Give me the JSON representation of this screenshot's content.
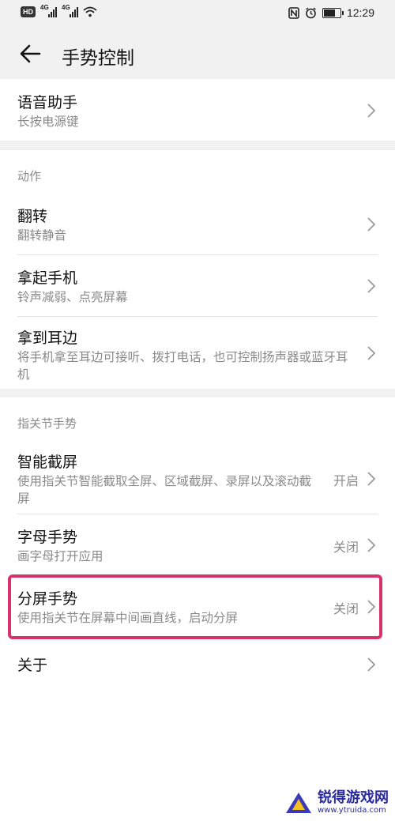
{
  "status_bar": {
    "hd": "HD",
    "net1": "4G",
    "net2": "4G",
    "time": "12:29",
    "battery_level": 0.8
  },
  "header": {
    "title": "手势控制"
  },
  "voice": {
    "title": "语音助手",
    "subtitle": "长按电源键"
  },
  "actions": {
    "section_label": "动作",
    "items": [
      {
        "title": "翻转",
        "subtitle": "翻转静音"
      },
      {
        "title": "拿起手机",
        "subtitle": "铃声减弱、点亮屏幕"
      },
      {
        "title": "拿到耳边",
        "subtitle": "将手机拿至耳边可接听、拨打电话，也可控制扬声器或蓝牙耳机"
      }
    ]
  },
  "knuckle": {
    "section_label": "指关节手势",
    "items": [
      {
        "title": "智能截屏",
        "subtitle": "使用指关节智能截取全屏、区域截屏、录屏以及滚动截屏",
        "value": "开启"
      },
      {
        "title": "字母手势",
        "subtitle": "画字母打开应用",
        "value": "关闭"
      },
      {
        "title": "分屏手势",
        "subtitle": "使用指关节在屏幕中间画直线，启动分屏",
        "value": "关闭"
      }
    ]
  },
  "about": {
    "title": "关于"
  },
  "watermark": {
    "name": "锐得游戏网",
    "url": "www.ytruida.com"
  },
  "colors": {
    "highlight": "#d8326c",
    "subtext": "#8a8a8a",
    "background": "#f1f1f1"
  }
}
